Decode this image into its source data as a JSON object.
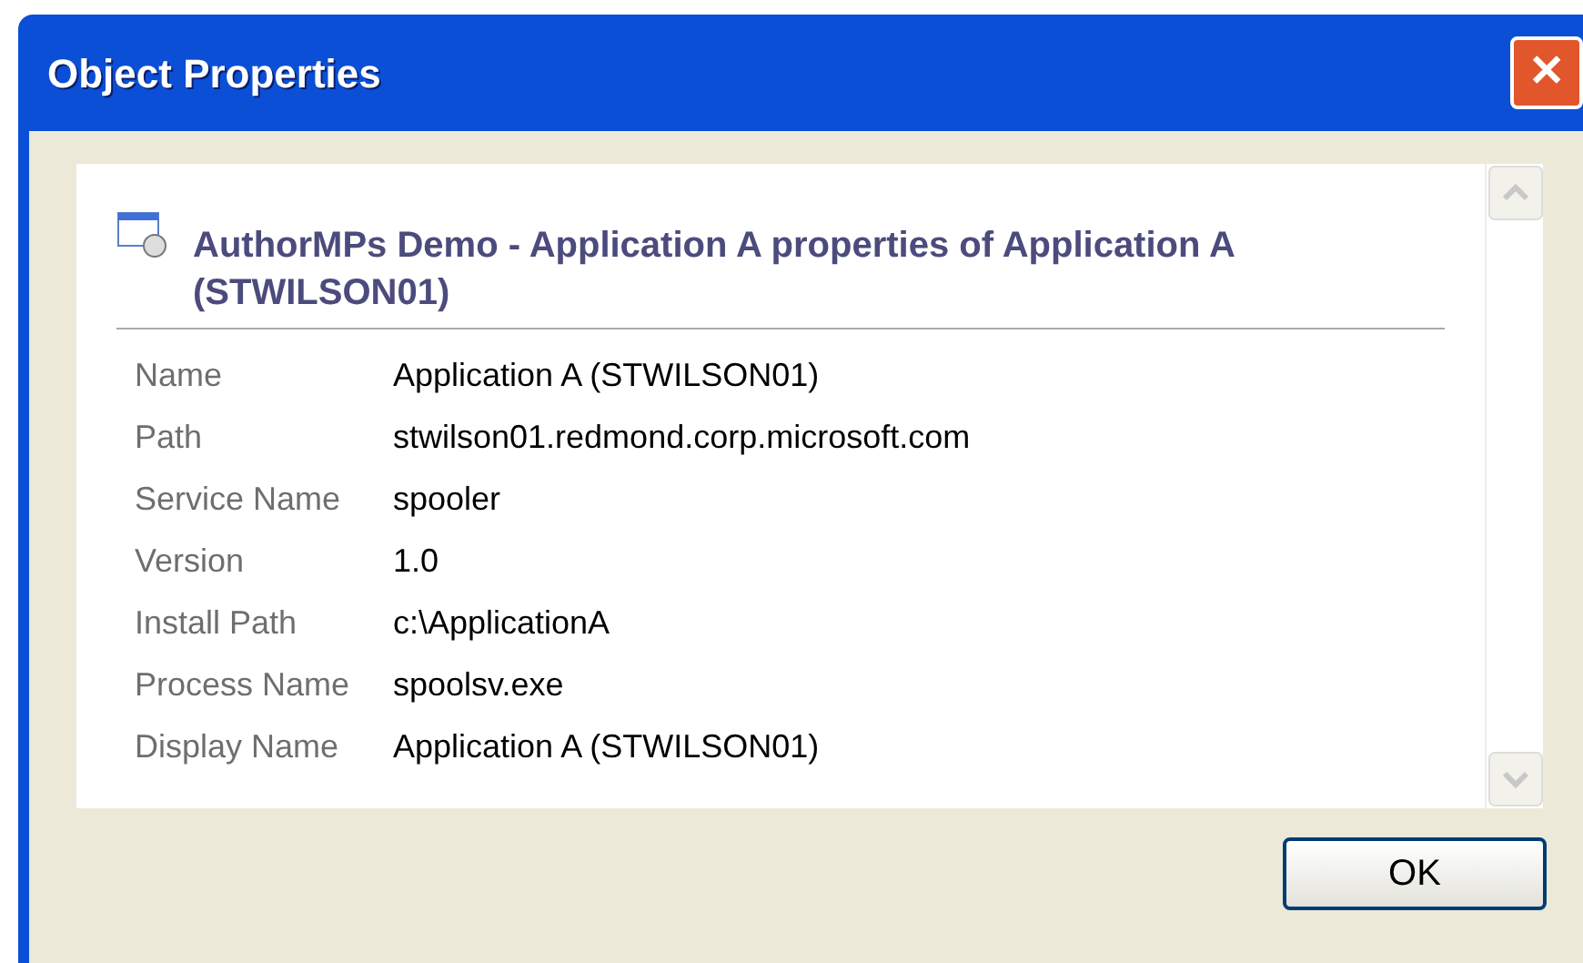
{
  "window": {
    "title": "Object Properties",
    "close": "✕"
  },
  "heading": "AuthorMPs Demo - Application A properties of Application A (STWILSON01)",
  "properties": [
    {
      "name": "Name",
      "value": "Application A (STWILSON01)"
    },
    {
      "name": "Path",
      "value": "stwilson01.redmond.corp.microsoft.com"
    },
    {
      "name": "Service Name",
      "value": "spooler"
    },
    {
      "name": "Version",
      "value": "1.0"
    },
    {
      "name": "Install Path",
      "value": "c:\\ApplicationA"
    },
    {
      "name": "Process Name",
      "value": "spoolsv.exe"
    },
    {
      "name": "Display Name",
      "value": "Application A (STWILSON01)"
    }
  ],
  "buttons": [
    "OK"
  ]
}
